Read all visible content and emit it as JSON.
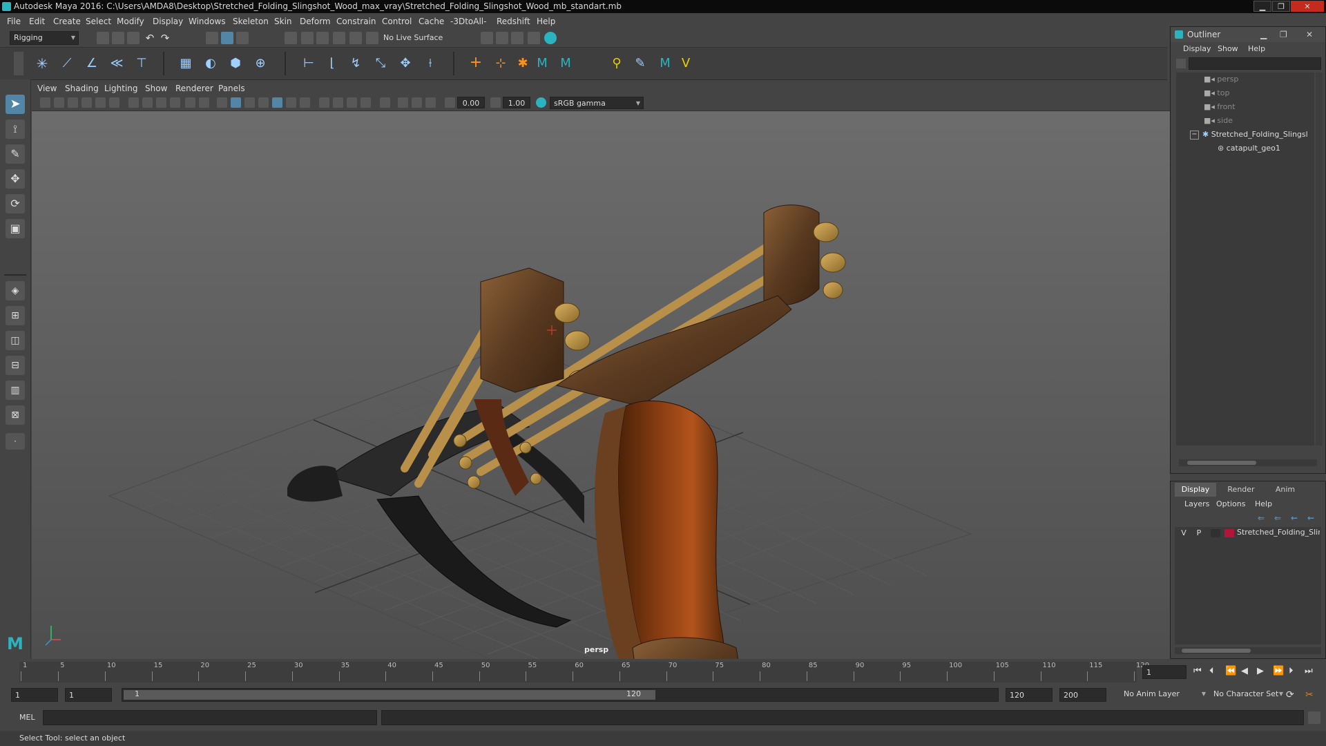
{
  "window": {
    "title": "Autodesk Maya 2016: C:\\Users\\AMDA8\\Desktop\\Stretched_Folding_Slingshot_Wood_max_vray\\Stretched_Folding_Slingshot_Wood_mb_standart.mb",
    "minimize": "▁",
    "maximize": "❐",
    "close": "✕"
  },
  "menubar": [
    "File",
    "Edit",
    "Create",
    "Select",
    "Modify",
    "Display",
    "Windows",
    "Skeleton",
    "Skin",
    "Deform",
    "Constrain",
    "Control",
    "Cache",
    "-3DtoAll-",
    "Redshift",
    "Help"
  ],
  "status": {
    "mode": "Rigging",
    "live_surface": "No Live Surface"
  },
  "viewport": {
    "menu": [
      "View",
      "Shading",
      "Lighting",
      "Show",
      "Renderer",
      "Panels"
    ],
    "near": "0.00",
    "far": "1.00",
    "colorspace": "sRGB gamma",
    "camera_label": "persp"
  },
  "outliner": {
    "title": "Outliner",
    "menu": [
      "Display",
      "Show",
      "Help"
    ],
    "items": [
      {
        "label": "persp",
        "type": "camera",
        "dim": true
      },
      {
        "label": "top",
        "type": "camera",
        "dim": true
      },
      {
        "label": "front",
        "type": "camera",
        "dim": true
      },
      {
        "label": "side",
        "type": "camera",
        "dim": true
      },
      {
        "label": "Stretched_Folding_Slingsl",
        "type": "group",
        "dim": false
      },
      {
        "label": "catapult_geo1",
        "type": "mesh",
        "dim": false
      }
    ],
    "expand": "−"
  },
  "layers": {
    "tabs": [
      "Display",
      "Render",
      "Anim"
    ],
    "active_tab": "Display",
    "menu": [
      "Layers",
      "Options",
      "Help"
    ],
    "layer": {
      "v": "V",
      "p": "P",
      "name": "Stretched_Folding_Slin",
      "color": "#b3143a"
    }
  },
  "timeline": {
    "ticks": [
      "1",
      "5",
      "10",
      "15",
      "20",
      "25",
      "30",
      "35",
      "40",
      "45",
      "50",
      "55",
      "60",
      "65",
      "70",
      "75",
      "80",
      "85",
      "90",
      "95",
      "100",
      "105",
      "110",
      "115",
      "120"
    ],
    "current_frame": "1"
  },
  "range": {
    "start": "1",
    "playback_start": "1",
    "slider_start": "1",
    "slider_end": "120",
    "playback_end": "120",
    "end": "200",
    "anim_layer": "No Anim Layer",
    "char_set": "No Character Set"
  },
  "cmd": {
    "label": "MEL"
  },
  "help": {
    "text": "Select Tool: select an object"
  },
  "colors": {
    "accent": "#5285a6",
    "layer_red": "#b3143a",
    "maya_teal": "#2bb3c0"
  }
}
